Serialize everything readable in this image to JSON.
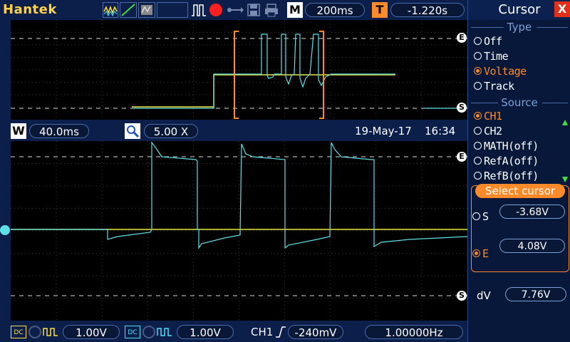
{
  "topbar": {
    "brand": "Hantek",
    "mode_badge": "M",
    "timebase": "200ms",
    "trigger_badge": "T",
    "trigger_pos": "-1.220s"
  },
  "zoombar": {
    "window_badge": "W",
    "window_time": "40.0ms",
    "zoom_factor": "5.00 X",
    "date": "19-May-17",
    "time": "16:34"
  },
  "markers": {
    "end": "E",
    "start": "S"
  },
  "bottombar": {
    "ch1_coupling": "DC",
    "ch1_scale": "1.00V",
    "ch2_coupling": "DC",
    "ch2_scale": "1.00V",
    "trig_source": "CH1",
    "trig_level": "-240mV",
    "frequency": "1.00000Hz"
  },
  "panel": {
    "title": "Cursor",
    "close_label": "X",
    "type_label": "Type",
    "type_options": [
      "Off",
      "Time",
      "Voltage",
      "Track"
    ],
    "type_selected": "Voltage",
    "source_label": "Source",
    "source_options": [
      "CH1",
      "CH2",
      "MATH(off)",
      "RefA(off)",
      "RefB(off)"
    ],
    "source_selected": "CH1",
    "select_label": "Select cursor",
    "s_label": "S",
    "s_value": "-3.68V",
    "e_label": "E",
    "e_value": "4.08V",
    "dv_label": "dV",
    "dv_value": "7.76V"
  },
  "colors": {
    "ch1": "#5ee0e8",
    "ch2": "#e8e840",
    "accent": "#ff8a2a",
    "brand": "#ffd24a"
  }
}
